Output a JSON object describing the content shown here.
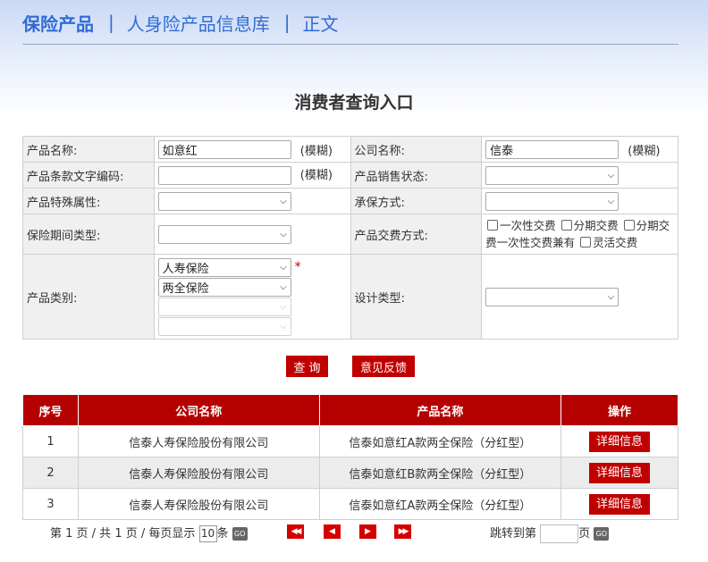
{
  "breadcrumb": {
    "home": "保险产品",
    "separator": "|",
    "level2": "人身险产品信息库",
    "level3": "正文"
  },
  "page_title": "消费者查询入口",
  "form": {
    "product_name": {
      "label": "产品名称:",
      "value": "如意红",
      "suffix": "(模糊)"
    },
    "company_name": {
      "label": "公司名称:",
      "value": "信泰",
      "suffix": "(模糊)"
    },
    "clause_code": {
      "label": "产品条款文字编码:",
      "value": "",
      "suffix": "(模糊)"
    },
    "sales_status": {
      "label": "产品销售状态:",
      "value": ""
    },
    "special_attr": {
      "label": "产品特殊属性:",
      "value": ""
    },
    "underwriting": {
      "label": "承保方式:",
      "value": ""
    },
    "period_type": {
      "label": "保险期间类型:",
      "value": ""
    },
    "payment": {
      "label": "产品交费方式:",
      "options": [
        "一次性交费",
        "分期交费",
        "分期交费一次性交费兼有",
        "灵活交费"
      ]
    },
    "category": {
      "label": "产品类别:",
      "sel1": "人寿保险",
      "sel2": "两全保险",
      "sel3": "",
      "sel4": "",
      "required": "*"
    },
    "design_type": {
      "label": "设计类型:",
      "value": ""
    }
  },
  "buttons": {
    "query": "查 询",
    "feedback": "意见反馈"
  },
  "results": {
    "headers": [
      "序号",
      "公司名称",
      "产品名称",
      "操作"
    ],
    "rows": [
      {
        "no": "1",
        "company": "信泰人寿保险股份有限公司",
        "product": "信泰如意红A款两全保险（分红型）",
        "action": "详细信息"
      },
      {
        "no": "2",
        "company": "信泰人寿保险股份有限公司",
        "product": "信泰如意红B款两全保险（分红型）",
        "action": "详细信息"
      },
      {
        "no": "3",
        "company": "信泰人寿保险股份有限公司",
        "product": "信泰如意红A款两全保险（分红型）",
        "action": "详细信息"
      }
    ]
  },
  "pager": {
    "info_prefix": "第 1 页 / 共 1 页 / 每页显示",
    "per_page": "10",
    "per_page_unit": "条",
    "go": "GO",
    "jump_label": "跳转到第",
    "jump_unit": "页",
    "first_icon": "◀◀",
    "prev_icon": "◀",
    "next_icon": "▶",
    "last_icon": "▶▶"
  }
}
